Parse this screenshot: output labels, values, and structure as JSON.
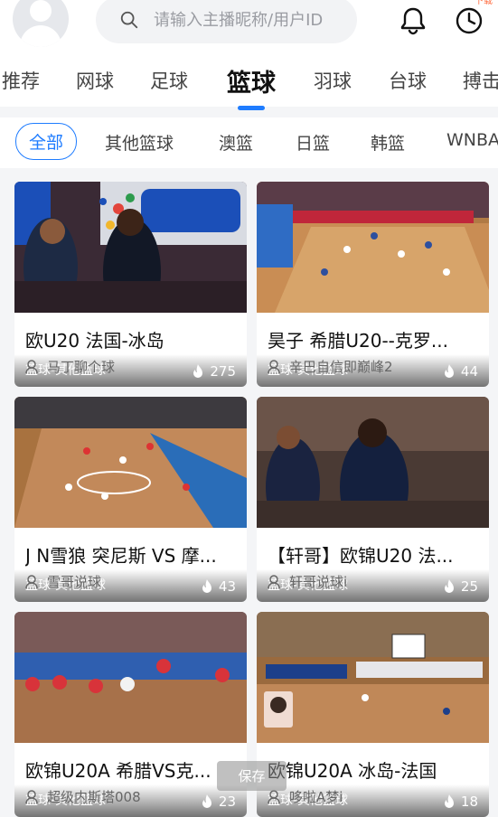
{
  "header": {
    "search_placeholder": "请输入主播昵称/用户ID",
    "corner_text": "下载",
    "icons": [
      "avatar",
      "search-icon",
      "bell-icon",
      "history-clock-icon"
    ]
  },
  "sport_tabs": [
    {
      "label": "推荐"
    },
    {
      "label": "网球"
    },
    {
      "label": "足球"
    },
    {
      "label": "篮球",
      "active": true
    },
    {
      "label": "羽球"
    },
    {
      "label": "台球"
    },
    {
      "label": "搏击"
    }
  ],
  "sub_tabs": [
    {
      "label": "全部",
      "active": true
    },
    {
      "label": "其他篮球"
    },
    {
      "label": "澳篮"
    },
    {
      "label": "日篮"
    },
    {
      "label": "韩篮"
    },
    {
      "label": "WNBA"
    }
  ],
  "cards": [
    {
      "category": "篮球-其他篮球",
      "heat": "275",
      "title": "欧U20 法国-冰岛",
      "anchor": "马丁聊个球"
    },
    {
      "category": "篮球-其他篮球",
      "heat": "44",
      "title": "昊子 希腊U20--克罗...",
      "anchor": "辛巴自信即巅峰2"
    },
    {
      "category": "篮球-其他篮球",
      "heat": "43",
      "title": "J N雪狼 突尼斯 VS 摩...",
      "anchor": "雪哥说球"
    },
    {
      "category": "篮球-其他篮球",
      "heat": "25",
      "title": "【轩哥】欧锦U20 法...",
      "anchor": "轩哥说球i"
    },
    {
      "category": "篮球-其他篮球",
      "heat": "23",
      "title": "欧锦U20A 希腊VS克...",
      "anchor": "超级内斯塔008"
    },
    {
      "category": "篮球-其他篮球",
      "heat": "18",
      "title": "欧锦U20A 冰岛-法国",
      "anchor": "哆啦A梦i"
    }
  ],
  "save_button": "保存",
  "colors": {
    "accent": "#1e7cff",
    "page_bg": "#f4f5f7"
  }
}
